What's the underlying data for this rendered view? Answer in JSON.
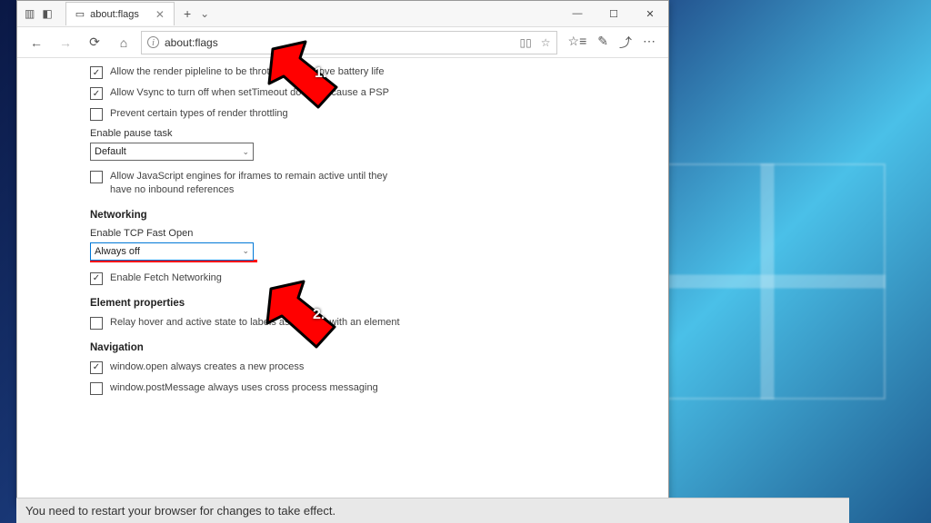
{
  "window": {
    "tab_title": "about:flags",
    "url": "about:flags"
  },
  "content": {
    "items": [
      {
        "type": "checkbox",
        "checked": true,
        "label": "Allow the render pipleline to be throttled to improve battery life"
      },
      {
        "type": "checkbox",
        "checked": true,
        "label": "Allow Vsync to turn off when setTimeout does not cause a PSP"
      },
      {
        "type": "checkbox",
        "checked": false,
        "label": "Prevent certain types of render throttling"
      },
      {
        "type": "label",
        "text": "Enable pause task"
      },
      {
        "type": "select",
        "value": "Default",
        "highlighted": false
      },
      {
        "type": "checkbox",
        "checked": false,
        "label": "Allow JavaScript engines for iframes to remain active until they have no inbound references"
      },
      {
        "type": "header",
        "text": "Networking"
      },
      {
        "type": "label",
        "text": "Enable TCP Fast Open"
      },
      {
        "type": "select",
        "value": "Always off",
        "highlighted": true,
        "red_underline": true
      },
      {
        "type": "checkbox",
        "checked": true,
        "label": "Enable Fetch Networking"
      },
      {
        "type": "header",
        "text": "Element properties"
      },
      {
        "type": "checkbox",
        "checked": false,
        "label": "Relay hover and active state to labels associated with an element"
      },
      {
        "type": "header",
        "text": "Navigation"
      },
      {
        "type": "checkbox",
        "checked": true,
        "label": "window.open always creates a new process"
      },
      {
        "type": "checkbox",
        "checked": false,
        "label": "window.postMessage always uses cross process messaging"
      }
    ]
  },
  "restart_message": "You need to restart your browser for changes to take effect.",
  "annotations": {
    "arrow1_label": "1.",
    "arrow2_label": "2."
  }
}
